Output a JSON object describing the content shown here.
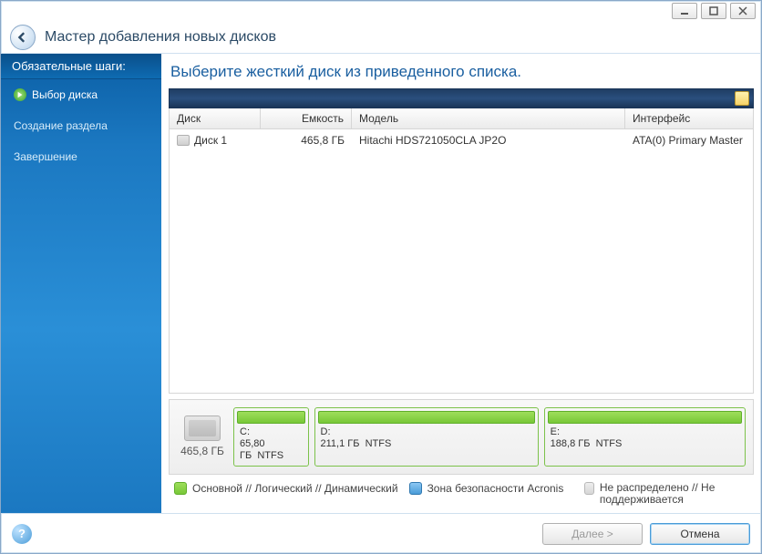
{
  "header": {
    "title": "Мастер добавления новых дисков"
  },
  "sidebar": {
    "heading": "Обязательные шаги:",
    "items": [
      {
        "label": "Выбор диска",
        "active": true
      },
      {
        "label": "Создание раздела",
        "active": false
      },
      {
        "label": "Завершение",
        "active": false
      }
    ]
  },
  "main": {
    "title": "Выберите жесткий диск из приведенного списка.",
    "columns": {
      "disk": "Диск",
      "capacity": "Емкость",
      "model": "Модель",
      "interface": "Интерфейс"
    },
    "rows": [
      {
        "disk": "Диск 1",
        "capacity": "465,8 ГБ",
        "model": "Hitachi HDS721050CLA JP2O",
        "interface": "ATA(0) Primary Master"
      }
    ]
  },
  "partitions": {
    "disk_total": "465,8 ГБ",
    "list": [
      {
        "letter": "C:",
        "size": "65,80 ГБ",
        "fs": "NTFS",
        "flex": 66
      },
      {
        "letter": "D:",
        "size": "211,1 ГБ",
        "fs": "NTFS",
        "flex": 211
      },
      {
        "letter": "E:",
        "size": "188,8 ГБ",
        "fs": "NTFS",
        "flex": 189
      }
    ]
  },
  "legend": {
    "types": "Основной // Логический // Динамический",
    "zone": "Зона безопасности Acronis",
    "unalloc": "Не распределено // Не поддерживается"
  },
  "footer": {
    "next": "Далее >",
    "cancel": "Отмена"
  }
}
